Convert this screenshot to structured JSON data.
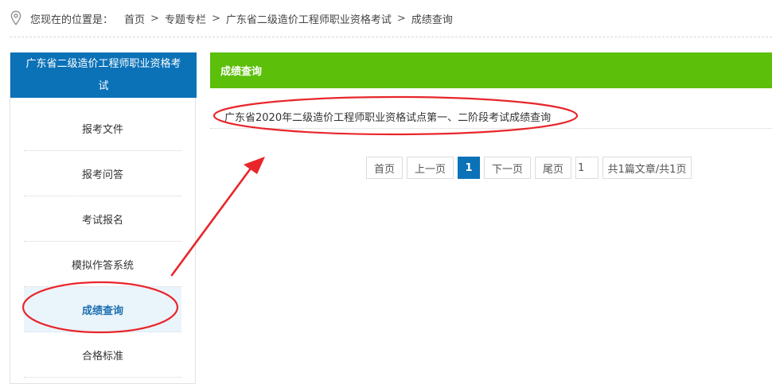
{
  "breadcrumb": {
    "prefix": "您现在的位置是：",
    "items": [
      "首页",
      "专题专栏",
      "广东省二级造价工程师职业资格考试",
      "成绩查询"
    ],
    "separator": ">"
  },
  "sidebar": {
    "title": "广东省二级造价工程师职业资格考试",
    "items": [
      {
        "label": "报考文件"
      },
      {
        "label": "报考问答"
      },
      {
        "label": "考试报名"
      },
      {
        "label": "模拟作答系统"
      },
      {
        "label": "成绩查询"
      },
      {
        "label": "合格标准"
      }
    ]
  },
  "main": {
    "heading": "成绩查询",
    "articles": [
      {
        "title": "广东省2020年二级造价工程师职业资格试点第一、二阶段考试成绩查询"
      }
    ]
  },
  "pagination": {
    "first": "首页",
    "prev": "上一页",
    "current": "1",
    "next": "下一页",
    "last": "尾页",
    "jump_value": "1",
    "summary": "共1篇文章/共1页"
  },
  "colors": {
    "sidebar_header": "#0b72b8",
    "main_header": "#5cbf0a",
    "annotation": "#e8262b"
  },
  "icons": {
    "breadcrumb": "location-pin-icon"
  }
}
